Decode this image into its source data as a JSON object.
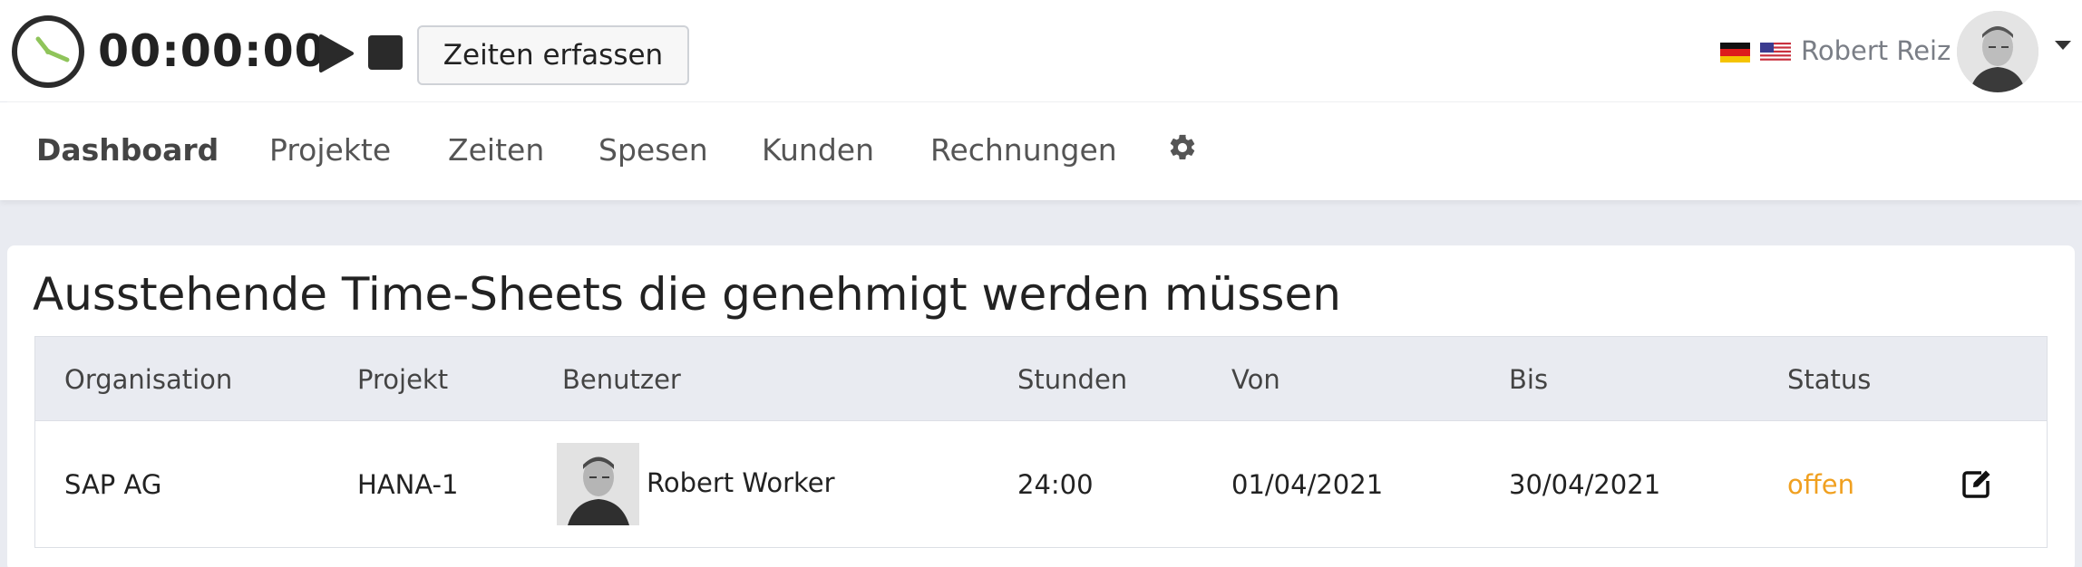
{
  "header": {
    "timer": "00:00:00",
    "track_button_label": "Zeiten erfassen",
    "user_name": "Robert Reiz",
    "icons": {
      "clock": "clock-icon",
      "play": "play-icon",
      "stop": "stop-icon",
      "flag_de": "flag-germany-icon",
      "flag_us": "flag-usa-icon",
      "caret": "chevron-down-icon"
    },
    "colors": {
      "clock_hand": "#8fc45a"
    }
  },
  "nav": {
    "items": [
      {
        "label": "Dashboard",
        "active": true
      },
      {
        "label": "Projekte",
        "active": false
      },
      {
        "label": "Zeiten",
        "active": false
      },
      {
        "label": "Spesen",
        "active": false
      },
      {
        "label": "Kunden",
        "active": false
      },
      {
        "label": "Rechnungen",
        "active": false
      }
    ],
    "settings_icon": "gear-icon"
  },
  "panel": {
    "title": "Ausstehende Time-Sheets die genehmigt werden müssen",
    "columns": [
      "Organisation",
      "Projekt",
      "Benutzer",
      "Stunden",
      "Von",
      "Bis",
      "Status"
    ],
    "rows": [
      {
        "organisation": "SAP AG",
        "projekt": "HANA-1",
        "benutzer": "Robert Worker",
        "stunden": "24:00",
        "von": "01/04/2021",
        "bis": "30/04/2021",
        "status": "offen",
        "action_icon": "edit-icon"
      }
    ],
    "colors": {
      "status_open": "#f0a020"
    }
  }
}
